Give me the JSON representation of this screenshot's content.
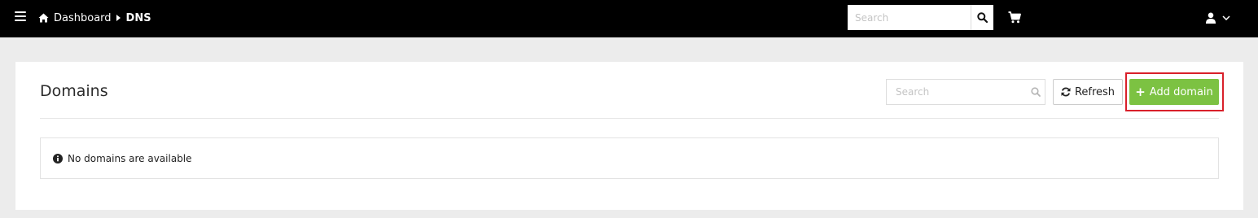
{
  "topbar": {
    "breadcrumb": {
      "home_label": "Dashboard",
      "current_label": "DNS"
    },
    "search": {
      "placeholder": "Search"
    },
    "icons": [
      "menu-icon",
      "home-icon",
      "search-icon",
      "cart-icon",
      "user-icon",
      "chevron-down-icon"
    ]
  },
  "panel": {
    "title": "Domains",
    "search": {
      "placeholder": "Search"
    },
    "refresh_label": "Refresh",
    "add_label": "Add domain",
    "add_color": "#7cc242",
    "highlight_color": "#d9202a",
    "notice": "No domains are available"
  }
}
